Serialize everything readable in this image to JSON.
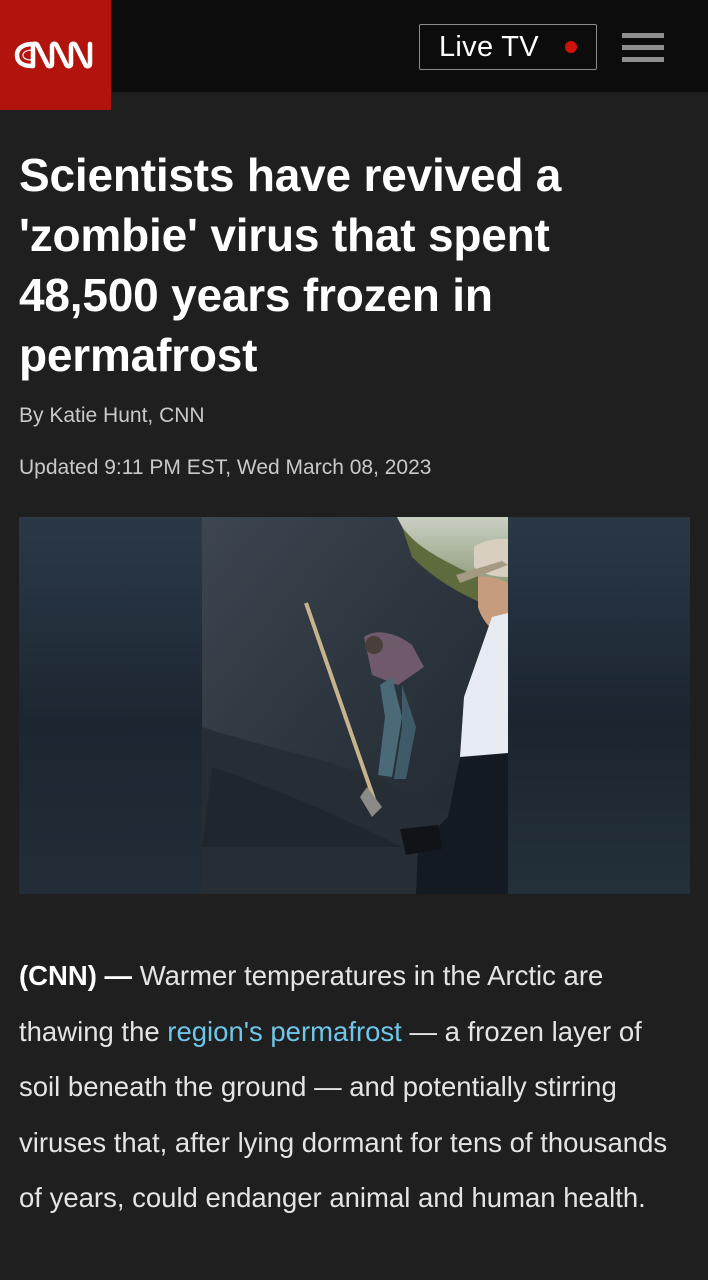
{
  "header": {
    "logo_text": "CNN",
    "live_tv_label": "Live TV",
    "menu_icon": "hamburger-menu-icon"
  },
  "article": {
    "headline": "Scientists have revived a 'zombie' virus that spent 48,500 years frozen in permafrost",
    "byline": "By Katie Hunt, CNN",
    "updated": "Updated 9:11 PM EST, Wed March 08, 2023",
    "body": {
      "dateline": "(CNN)",
      "dash": " — ",
      "text_1": "Warmer temperatures in the Arctic are thawing the ",
      "link_text": "region's permafrost",
      "text_2": " — a frozen layer of soil beneath the ground — and potentially stirring viruses that, after lying dormant for tens of thousands of years, could endanger animal and human health."
    }
  },
  "colors": {
    "brand_red": "#b3130d",
    "live_dot": "#d0100c",
    "background": "#1f1f1f",
    "topbar": "#0c0c0c",
    "link": "#6ec6ea"
  }
}
